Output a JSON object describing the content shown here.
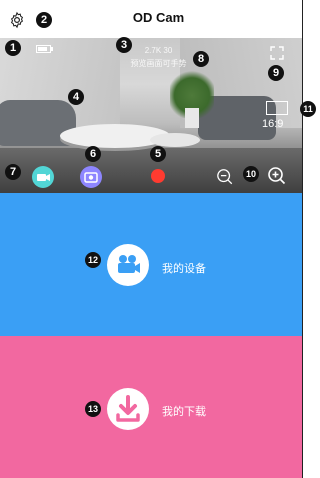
{
  "header": {
    "title": "OD Cam"
  },
  "preview": {
    "resolution": "2.7K 30",
    "hint": "预览画面可手势",
    "aspect_ratio": "16:9"
  },
  "controls": {
    "video_mode_icon": "video-camera-icon",
    "photo_mode_icon": "camera-icon",
    "record_icon": "record-dot-icon",
    "zoom_out_icon": "zoom-out-icon",
    "zoom_in_icon": "zoom-in-icon",
    "fullscreen_icon": "fullscreen-icon"
  },
  "panels": [
    {
      "label": "我的设备",
      "icon": "movie-camera-icon",
      "color": "#3a9ff5"
    },
    {
      "label": "我的下载",
      "icon": "download-icon",
      "color": "#f268a0"
    }
  ],
  "annotations": [
    "1",
    "2",
    "3",
    "4",
    "5",
    "6",
    "7",
    "8",
    "9",
    "10",
    "11",
    "12",
    "13"
  ]
}
